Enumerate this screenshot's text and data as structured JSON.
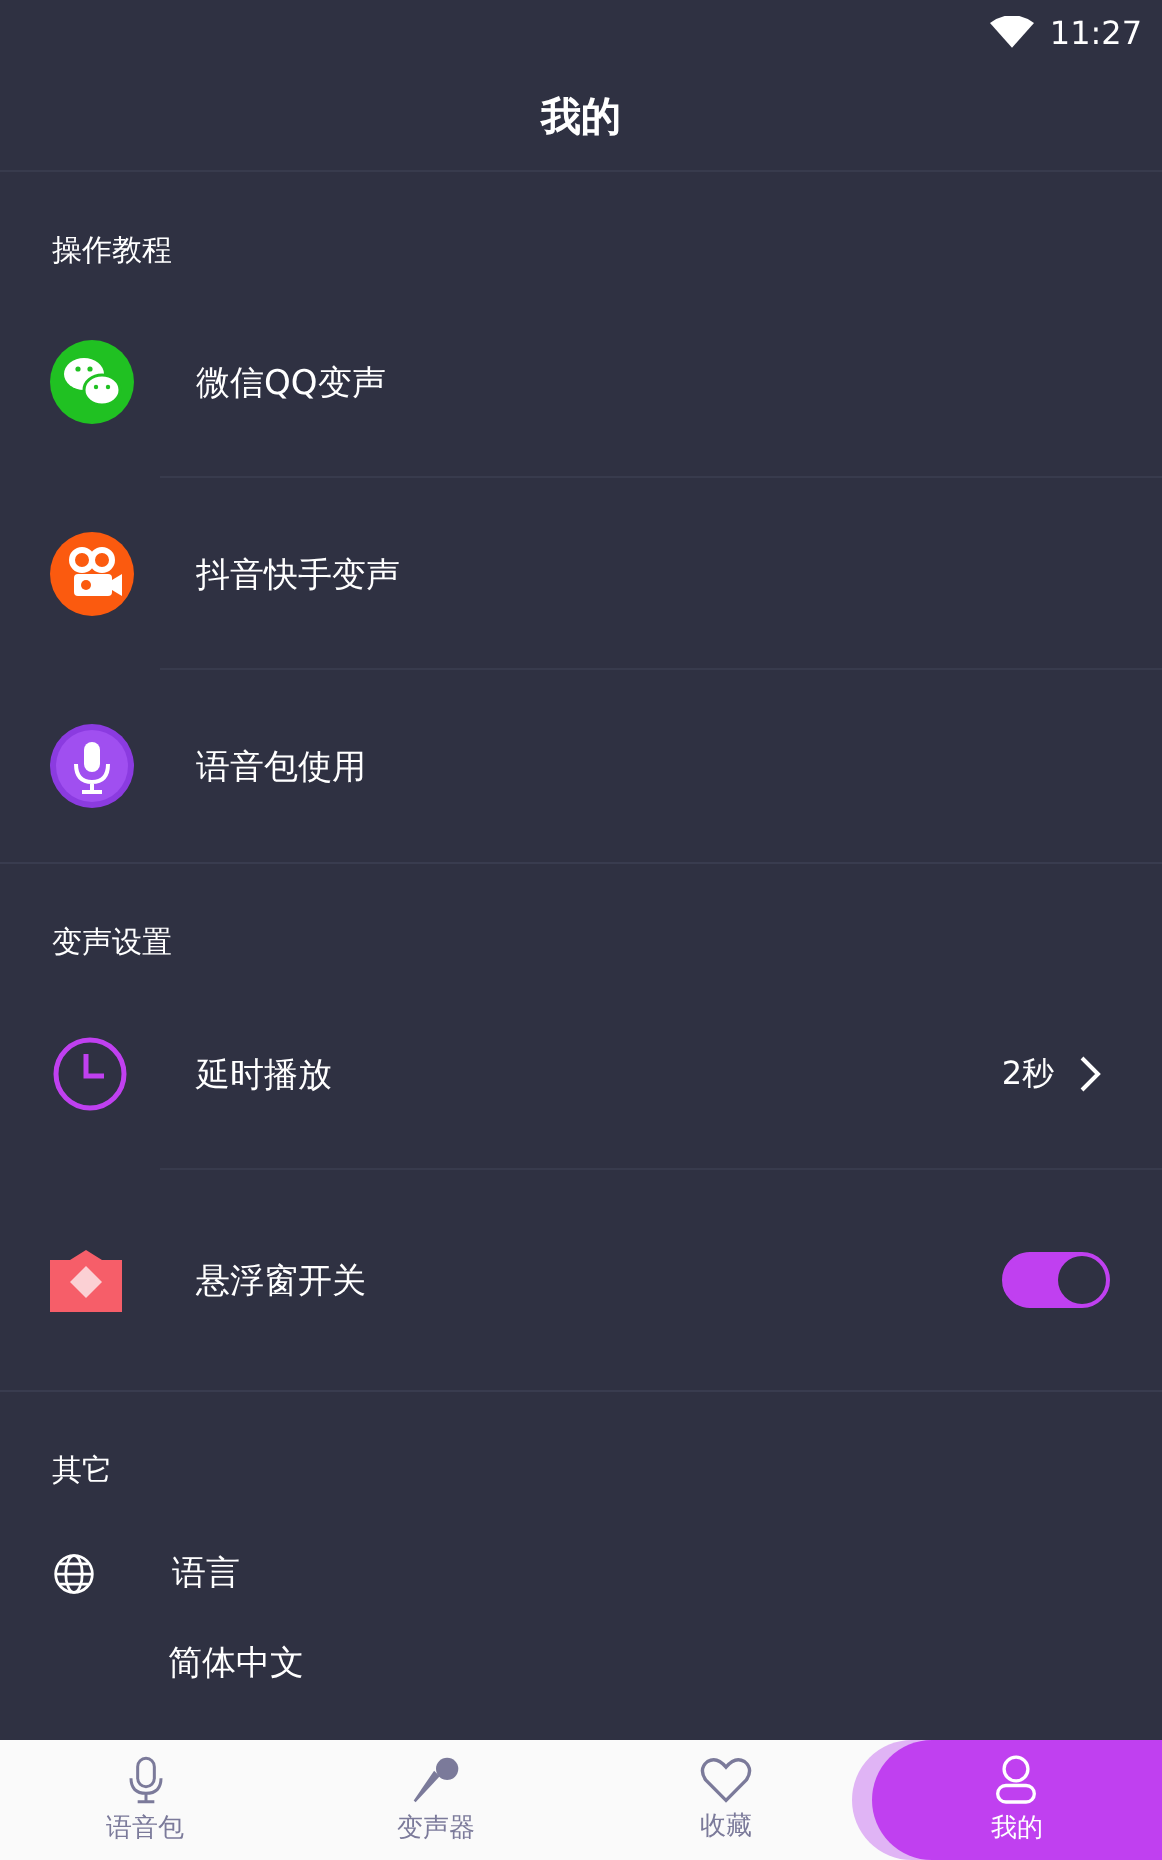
{
  "status_bar": {
    "time": "11:27"
  },
  "title": "我的",
  "sections": [
    {
      "header": "操作教程",
      "items": [
        {
          "kind": "link",
          "label": "微信QQ变声"
        },
        {
          "kind": "link",
          "label": "抖音快手变声"
        },
        {
          "kind": "link",
          "label": "语音包使用"
        }
      ]
    },
    {
      "header": "变声设置",
      "items": [
        {
          "kind": "value",
          "label": "延时播放",
          "value": "2秒"
        },
        {
          "kind": "toggle",
          "label": "悬浮窗开关",
          "on": true
        }
      ]
    },
    {
      "header": "其它",
      "items": [
        {
          "kind": "option",
          "label": "语言",
          "value": "简体中文"
        }
      ]
    }
  ],
  "tabs": [
    {
      "label": "语音包",
      "selected": false
    },
    {
      "label": "变声器",
      "selected": false
    },
    {
      "label": "收藏",
      "selected": false
    },
    {
      "label": "我的",
      "selected": true
    }
  ]
}
